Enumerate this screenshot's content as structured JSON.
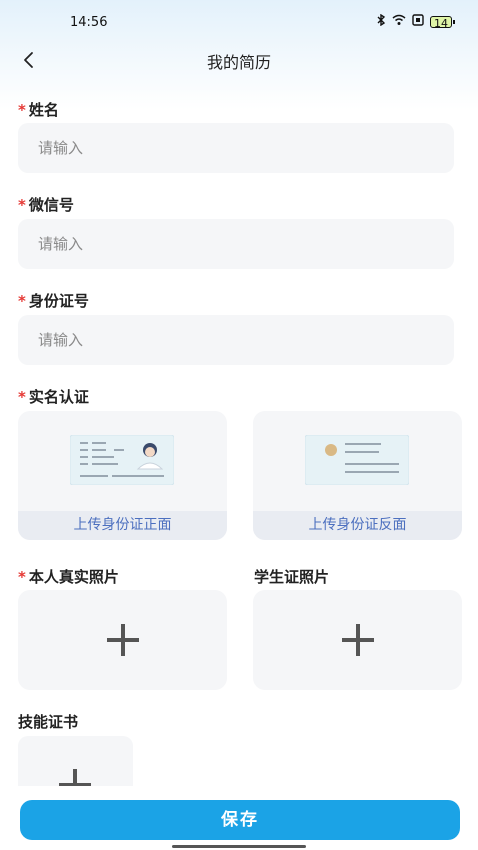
{
  "status_bar": {
    "time": "14:56",
    "battery": "14"
  },
  "header": {
    "title": "我的简历"
  },
  "form": {
    "required_mark": "*",
    "name": {
      "label": "姓名",
      "placeholder": "请输入"
    },
    "wechat": {
      "label": "微信号",
      "placeholder": "请输入"
    },
    "id_number": {
      "label": "身份证号",
      "placeholder": "请输入"
    },
    "real_name": {
      "label": "实名认证",
      "front_caption": "上传身份证正面",
      "back_caption": "上传身份证反面"
    },
    "personal_photo": {
      "label": "本人真实照片"
    },
    "student_card": {
      "label": "学生证照片"
    },
    "skill_certificate": {
      "label": "技能证书"
    }
  },
  "footer": {
    "save_label": "保存"
  },
  "colors": {
    "accent": "#1ba3e6",
    "required": "#e53935",
    "caption_text": "#4c6fbf"
  },
  "icons": [
    "back-icon",
    "bluetooth-icon",
    "wifi-icon",
    "sim-icon",
    "battery-icon",
    "plus-icon"
  ]
}
